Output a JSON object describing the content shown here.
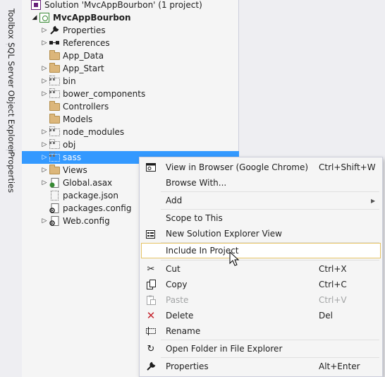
{
  "side_tabs": [
    {
      "label": "Toolbox"
    },
    {
      "label": "SQL Server Object Explorer"
    },
    {
      "label": "Properties"
    }
  ],
  "tree": {
    "solution_label": "Solution 'MvcAppBourbon' (1 project)",
    "project_label": "MvcAppBourbon",
    "items": [
      {
        "label": "Properties",
        "icon": "wrench-icon"
      },
      {
        "label": "References",
        "icon": "references-icon"
      },
      {
        "label": "App_Data",
        "icon": "folder-icon"
      },
      {
        "label": "App_Start",
        "icon": "folder-icon"
      },
      {
        "label": "bin",
        "icon": "excluded-folder-icon"
      },
      {
        "label": "bower_components",
        "icon": "excluded-folder-icon"
      },
      {
        "label": "Controllers",
        "icon": "folder-icon"
      },
      {
        "label": "Models",
        "icon": "folder-icon"
      },
      {
        "label": "node_modules",
        "icon": "excluded-folder-icon"
      },
      {
        "label": "obj",
        "icon": "excluded-folder-icon"
      },
      {
        "label": "sass",
        "icon": "excluded-folder-icon"
      },
      {
        "label": "Views",
        "icon": "folder-icon"
      },
      {
        "label": "Global.asax",
        "icon": "asax-file-icon"
      },
      {
        "label": "package.json",
        "icon": "excluded-file-icon"
      },
      {
        "label": "packages.config",
        "icon": "config-file-icon"
      },
      {
        "label": "Web.config",
        "icon": "config-file-icon"
      }
    ]
  },
  "context_menu": {
    "items": [
      {
        "label": "View in Browser (Google Chrome)",
        "shortcut": "Ctrl+Shift+W",
        "icon": "browser-icon"
      },
      {
        "label": "Browse With...",
        "shortcut": ""
      },
      {
        "label": "Add",
        "shortcut": ""
      },
      {
        "label": "Scope to This",
        "shortcut": ""
      },
      {
        "label": "New Solution Explorer View",
        "shortcut": "",
        "icon": "new-view-icon"
      },
      {
        "label": "Include In Project",
        "shortcut": ""
      },
      {
        "label": "Cut",
        "shortcut": "Ctrl+X",
        "icon": "scissors-icon"
      },
      {
        "label": "Copy",
        "shortcut": "Ctrl+C",
        "icon": "copy-icon"
      },
      {
        "label": "Paste",
        "shortcut": "Ctrl+V",
        "icon": "paste-icon"
      },
      {
        "label": "Delete",
        "shortcut": "Del",
        "icon": "delete-icon"
      },
      {
        "label": "Rename",
        "shortcut": "",
        "icon": "rename-icon"
      },
      {
        "label": "Open Folder in File Explorer",
        "shortcut": "",
        "icon": "refresh-arrow-icon"
      },
      {
        "label": "Properties",
        "shortcut": "Alt+Enter",
        "icon": "wrench-icon"
      }
    ]
  },
  "colors": {
    "selection": "#3399ff",
    "menu_highlight_border": "#e5c365",
    "delete_red": "#c5262f"
  }
}
